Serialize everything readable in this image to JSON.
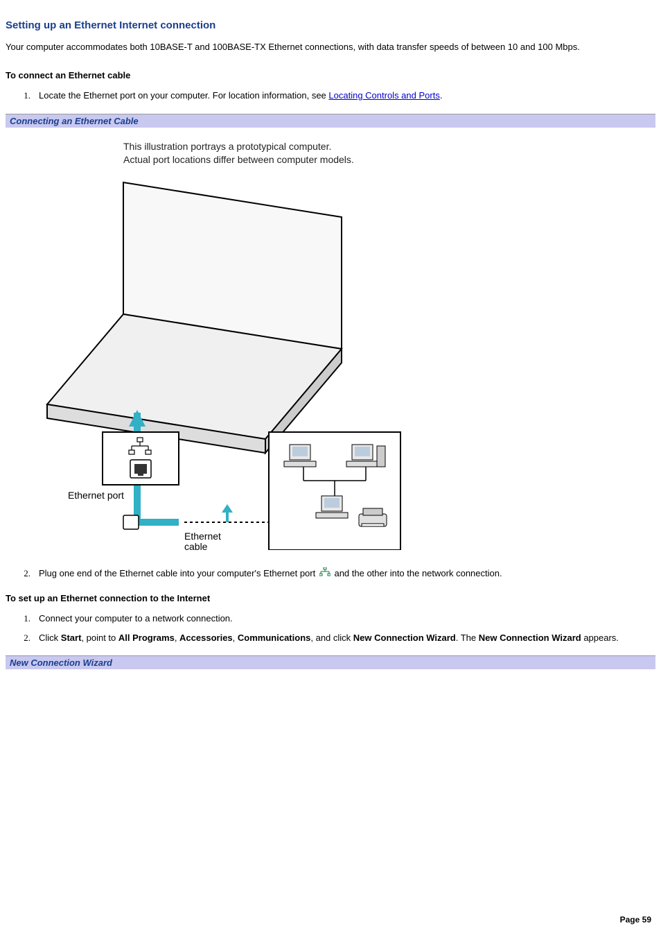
{
  "title": "Setting up an Ethernet Internet connection",
  "intro": "Your computer accommodates both 10BASE-T and 100BASE-TX Ethernet connections, with data transfer speeds of between 10 and 100 Mbps.",
  "subheading1": "To connect an Ethernet cable",
  "step1_pre": "Locate the Ethernet port on your computer. For location information, see ",
  "step1_link": "Locating Controls and Ports",
  "step1_post": ".",
  "callout1": "Connecting an Ethernet Cable",
  "illus_line1": "This illustration portrays a prototypical computer.",
  "illus_line2": "Actual port locations differ between computer models.",
  "label_ethernet_port": "Ethernet port",
  "label_ethernet_cable_1": "Ethernet",
  "label_ethernet_cable_2": "cable",
  "step2_pre": "Plug one end of the Ethernet cable into your computer's Ethernet port ",
  "step2_post": "and the other into the network connection.",
  "subheading2": "To set up an Ethernet connection to the Internet",
  "setup_step1": "Connect your computer to a network connection.",
  "setup_step2_p1": "Click ",
  "setup_step2_b1": "Start",
  "setup_step2_p2": ", point to ",
  "setup_step2_b2": "All Programs",
  "setup_step2_p3": ", ",
  "setup_step2_b3": "Accessories",
  "setup_step2_p4": ", ",
  "setup_step2_b4": "Communications",
  "setup_step2_p5": ", and click ",
  "setup_step2_b5": "New Connection Wizard",
  "setup_step2_p6": ". The ",
  "setup_step2_b6": "New Connection Wizard",
  "setup_step2_p7": " appears.",
  "callout2": "New Connection Wizard",
  "page_number": "Page 59",
  "nums": {
    "n1": "1.",
    "n2": "2."
  }
}
